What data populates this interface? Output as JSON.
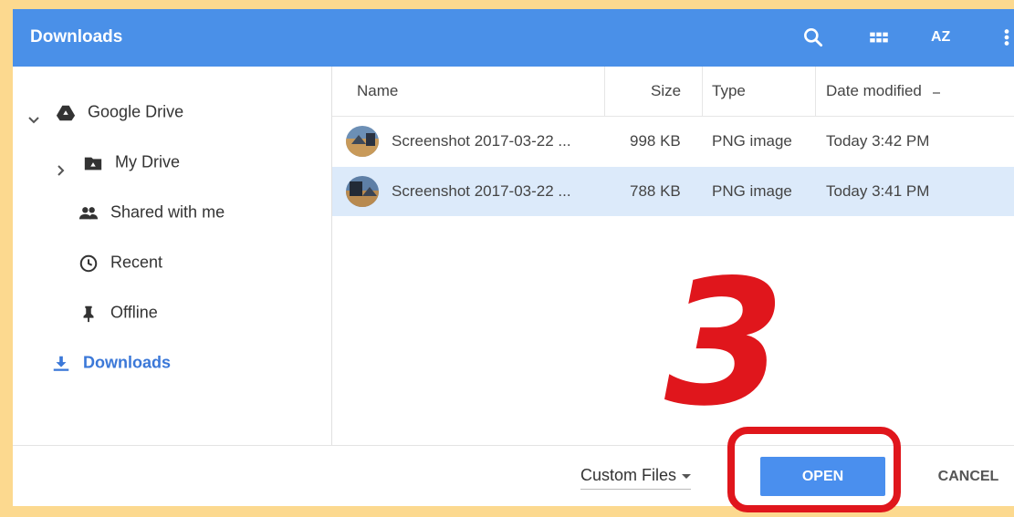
{
  "window": {
    "title": "Downloads"
  },
  "toolbar": {
    "search_icon": "search-icon",
    "grid_icon": "grid-view-icon",
    "sort_label": "AZ",
    "more_icon": "more-vert-icon"
  },
  "sidebar": {
    "items": [
      {
        "label": "Google Drive",
        "icon": "google-drive-icon"
      },
      {
        "label": "My Drive",
        "icon": "folder-icon"
      },
      {
        "label": "Shared with me",
        "icon": "people-icon"
      },
      {
        "label": "Recent",
        "icon": "clock-icon"
      },
      {
        "label": "Offline",
        "icon": "pin-icon"
      },
      {
        "label": "Downloads",
        "icon": "download-icon"
      }
    ]
  },
  "columns": {
    "name": "Name",
    "size": "Size",
    "type": "Type",
    "date": "Date modified"
  },
  "files": [
    {
      "name": "Screenshot 2017-03-22 ...",
      "size": "998 KB",
      "type": "PNG image",
      "date": "Today 3:42 PM"
    },
    {
      "name": "Screenshot 2017-03-22 ...",
      "size": "788 KB",
      "type": "PNG image",
      "date": "Today 3:41 PM"
    }
  ],
  "footer": {
    "filter_label": "Custom Files",
    "open_label": "OPEN",
    "cancel_label": "CANCEL"
  },
  "annotation": {
    "step_number": "3",
    "color": "#e0161c"
  },
  "colors": {
    "accent": "#4a90e8",
    "selected_row": "#dceafa",
    "active_nav": "#3b78d8"
  }
}
